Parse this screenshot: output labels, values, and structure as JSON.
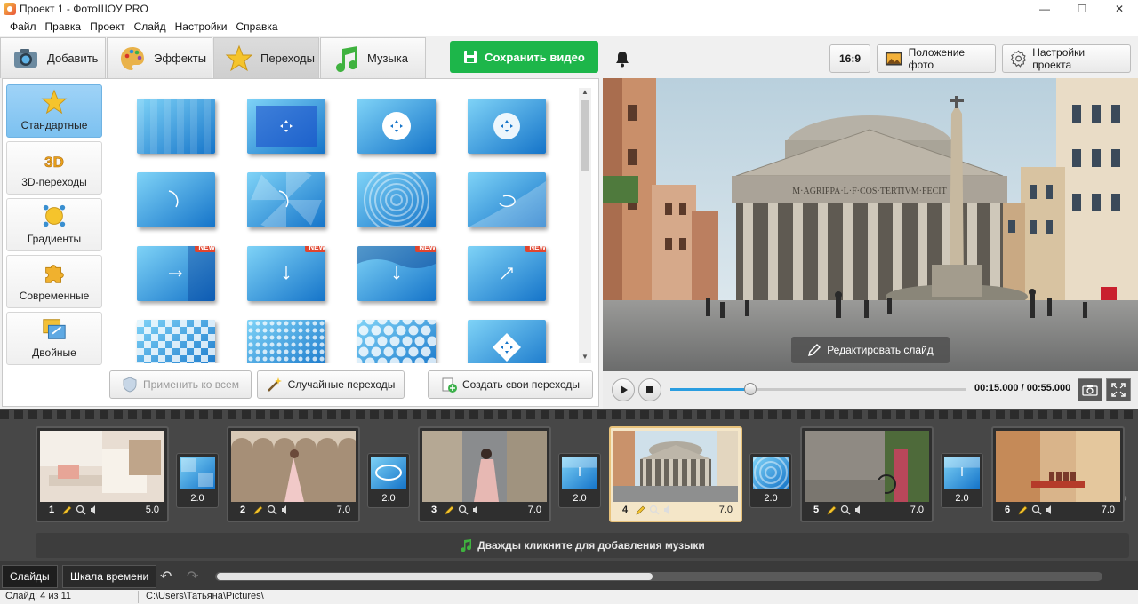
{
  "window": {
    "title": "Проект 1 - ФотоШОУ PRO",
    "minimize": "—",
    "maximize": "☐",
    "close": "✕"
  },
  "menu": [
    "Файл",
    "Правка",
    "Проект",
    "Слайд",
    "Настройки",
    "Справка"
  ],
  "tabs": [
    {
      "label": "Добавить",
      "icon": "camera-icon"
    },
    {
      "label": "Эффекты",
      "icon": "palette-icon"
    },
    {
      "label": "Переходы",
      "icon": "star-icon",
      "active": true
    },
    {
      "label": "Музыка",
      "icon": "music-note-icon"
    }
  ],
  "save_button": {
    "label": "Сохранить видео",
    "color": "#1db64a"
  },
  "categories": [
    {
      "label": "Стандартные",
      "icon": "star-icon",
      "active": true
    },
    {
      "label": "3D-переходы",
      "icon": "3d-icon",
      "glyph": "3D"
    },
    {
      "label": "Градиенты",
      "icon": "gradient-icon"
    },
    {
      "label": "Современные",
      "icon": "puzzle-icon"
    },
    {
      "label": "Двойные",
      "icon": "double-icon"
    }
  ],
  "new_badge": "NEW",
  "transitions": [
    {
      "pattern": "plain"
    },
    {
      "pattern": "arrows"
    },
    {
      "pattern": "circle-arrows"
    },
    {
      "pattern": "circle-arrows-light"
    },
    {
      "pattern": "curve-arrow"
    },
    {
      "pattern": "pinwheel"
    },
    {
      "pattern": "ripple"
    },
    {
      "pattern": "page-curl"
    },
    {
      "pattern": "arrow-right",
      "new": true
    },
    {
      "pattern": "arrow-down",
      "new": true
    },
    {
      "pattern": "wave-down",
      "new": true
    },
    {
      "pattern": "diag-arrow",
      "new": true
    },
    {
      "pattern": "checker"
    },
    {
      "pattern": "dots"
    },
    {
      "pattern": "hexagons"
    },
    {
      "pattern": "diamond"
    }
  ],
  "panel_buttons": {
    "apply_all": "Применить ко всем",
    "random": "Случайные переходы",
    "create": "Создать свои переходы"
  },
  "header": {
    "ratio": "16:9",
    "photo_position": "Положение фото",
    "project_settings": "Настройки проекта"
  },
  "preview": {
    "edit_slide": "Редактировать слайд",
    "inscription": "M·AGRIPPA·L·F·COS·TERTIVM·FECIT"
  },
  "player": {
    "time": "00:15.000 / 00:55.000",
    "progress": 0.27
  },
  "slides": [
    {
      "num": "1",
      "duration": "5.0",
      "scene": "interior",
      "trans": "2.0",
      "trans_pattern": "tiles"
    },
    {
      "num": "2",
      "duration": "7.0",
      "scene": "arcade",
      "trans": "2.0",
      "trans_pattern": "ellipse"
    },
    {
      "num": "3",
      "duration": "7.0",
      "scene": "alley",
      "trans": "2.0",
      "trans_pattern": "down"
    },
    {
      "num": "4",
      "duration": "7.0",
      "scene": "pantheon",
      "trans": "2.0",
      "trans_pattern": "ripple",
      "active": true
    },
    {
      "num": "5",
      "duration": "7.0",
      "scene": "street",
      "trans": "2.0",
      "trans_pattern": "down"
    },
    {
      "num": "6",
      "duration": "7.0",
      "scene": "facades"
    }
  ],
  "music_lane": "Дважды кликните для добавления музыки",
  "bottom_tabs": {
    "slides": "Слайды",
    "timeline": "Шкала времени"
  },
  "status": {
    "slide": "Слайд: 4 из 11",
    "path": "C:\\Users\\Татьяна\\Pictures\\"
  },
  "colors": {
    "accent_blue": "#2a9de0",
    "active_slide": "#e8c27a",
    "new_badge": "#e0452f"
  }
}
